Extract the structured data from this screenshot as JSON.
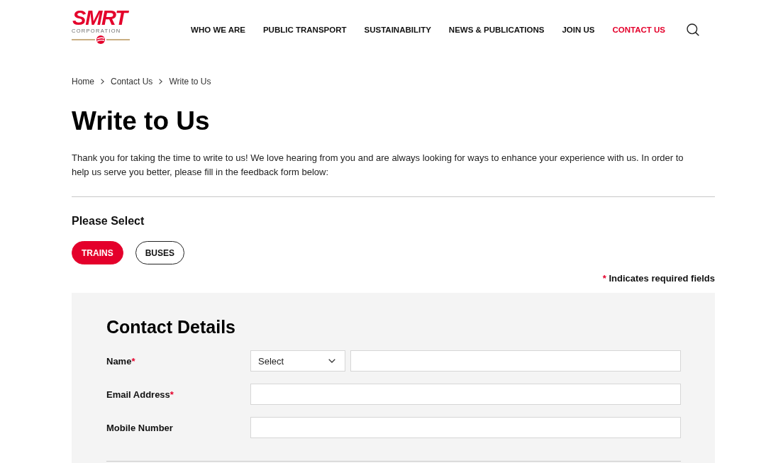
{
  "header": {
    "logo": {
      "wordmark": "SMRT",
      "tagline": "CORPORATION"
    },
    "nav": [
      {
        "label": "WHO WE ARE",
        "selected": false
      },
      {
        "label": "PUBLIC TRANSPORT",
        "selected": false
      },
      {
        "label": "SUSTAINABILITY",
        "selected": false
      },
      {
        "label": "NEWS & PUBLICATIONS",
        "selected": false
      },
      {
        "label": "JOIN US",
        "selected": false
      },
      {
        "label": "CONTACT US",
        "selected": true
      }
    ]
  },
  "breadcrumb": [
    "Home",
    "Contact Us",
    "Write to Us"
  ],
  "title": "Write to Us",
  "intro": "Thank you for taking the time to write to us! We love hearing from you and are always looking for ways to enhance your experience with us. In order to help us serve you better, please fill in the feedback form below:",
  "selector": {
    "heading": "Please Select",
    "options": [
      {
        "label": "TRAINS",
        "selected": true
      },
      {
        "label": "BUSES",
        "selected": false
      }
    ]
  },
  "required_note": {
    "mark": "*",
    "text": "Indicates required fields"
  },
  "form": {
    "heading": "Contact Details",
    "required_mark": "*",
    "fields": [
      {
        "label": "Name",
        "required": true,
        "kind": "select_text",
        "select": {
          "value": "Select"
        }
      },
      {
        "label": "Email Address",
        "required": true,
        "kind": "text"
      },
      {
        "label": "Mobile Number",
        "required": false,
        "kind": "text"
      }
    ]
  }
}
